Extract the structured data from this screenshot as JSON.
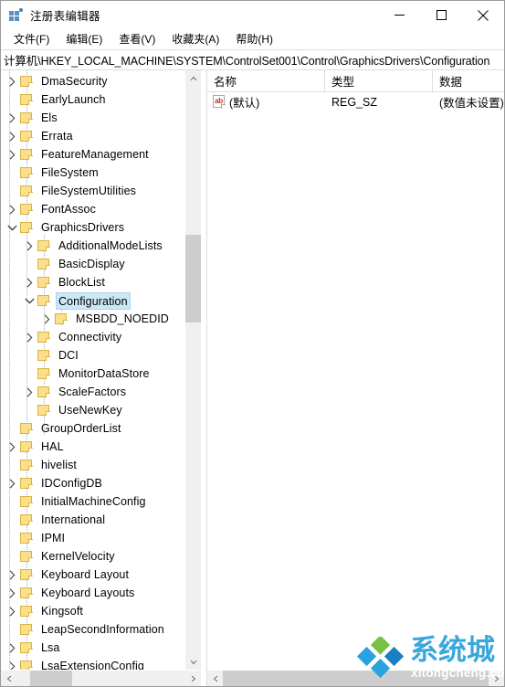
{
  "window": {
    "title": "注册表编辑器",
    "icon": "registry-editor-icon",
    "controls": {
      "minimize": "minimize-button",
      "maximize": "maximize-button",
      "close": "close-button"
    }
  },
  "menubar": {
    "items": [
      {
        "label": "文件(F)",
        "name": "menu-file"
      },
      {
        "label": "编辑(E)",
        "name": "menu-edit"
      },
      {
        "label": "查看(V)",
        "name": "menu-view"
      },
      {
        "label": "收藏夹(A)",
        "name": "menu-favorites"
      },
      {
        "label": "帮助(H)",
        "name": "menu-help"
      }
    ]
  },
  "address": {
    "path": "计算机\\HKEY_LOCAL_MACHINE\\SYSTEM\\ControlSet001\\Control\\GraphicsDrivers\\Configuration"
  },
  "tree": {
    "rows": [
      {
        "label": "DmaSecurity",
        "depth": 1,
        "expander": "collapsed",
        "selected": false
      },
      {
        "label": "EarlyLaunch",
        "depth": 1,
        "expander": "none",
        "selected": false
      },
      {
        "label": "Els",
        "depth": 1,
        "expander": "collapsed",
        "selected": false
      },
      {
        "label": "Errata",
        "depth": 1,
        "expander": "collapsed",
        "selected": false
      },
      {
        "label": "FeatureManagement",
        "depth": 1,
        "expander": "collapsed",
        "selected": false
      },
      {
        "label": "FileSystem",
        "depth": 1,
        "expander": "none",
        "selected": false
      },
      {
        "label": "FileSystemUtilities",
        "depth": 1,
        "expander": "none",
        "selected": false
      },
      {
        "label": "FontAssoc",
        "depth": 1,
        "expander": "collapsed",
        "selected": false
      },
      {
        "label": "GraphicsDrivers",
        "depth": 1,
        "expander": "expanded",
        "selected": false
      },
      {
        "label": "AdditionalModeLists",
        "depth": 2,
        "expander": "collapsed",
        "selected": false
      },
      {
        "label": "BasicDisplay",
        "depth": 2,
        "expander": "none",
        "selected": false
      },
      {
        "label": "BlockList",
        "depth": 2,
        "expander": "collapsed",
        "selected": false
      },
      {
        "label": "Configuration",
        "depth": 2,
        "expander": "expanded",
        "selected": true
      },
      {
        "label": "MSBDD_NOEDID",
        "depth": 3,
        "expander": "collapsed",
        "selected": false
      },
      {
        "label": "Connectivity",
        "depth": 2,
        "expander": "collapsed",
        "selected": false
      },
      {
        "label": "DCI",
        "depth": 2,
        "expander": "none",
        "selected": false
      },
      {
        "label": "MonitorDataStore",
        "depth": 2,
        "expander": "none",
        "selected": false
      },
      {
        "label": "ScaleFactors",
        "depth": 2,
        "expander": "collapsed",
        "selected": false
      },
      {
        "label": "UseNewKey",
        "depth": 2,
        "expander": "none",
        "selected": false
      },
      {
        "label": "GroupOrderList",
        "depth": 1,
        "expander": "none",
        "selected": false
      },
      {
        "label": "HAL",
        "depth": 1,
        "expander": "collapsed",
        "selected": false
      },
      {
        "label": "hivelist",
        "depth": 1,
        "expander": "none",
        "selected": false
      },
      {
        "label": "IDConfigDB",
        "depth": 1,
        "expander": "collapsed",
        "selected": false
      },
      {
        "label": "InitialMachineConfig",
        "depth": 1,
        "expander": "none",
        "selected": false
      },
      {
        "label": "International",
        "depth": 1,
        "expander": "none",
        "selected": false
      },
      {
        "label": "IPMI",
        "depth": 1,
        "expander": "none",
        "selected": false
      },
      {
        "label": "KernelVelocity",
        "depth": 1,
        "expander": "none",
        "selected": false
      },
      {
        "label": "Keyboard Layout",
        "depth": 1,
        "expander": "collapsed",
        "selected": false
      },
      {
        "label": "Keyboard Layouts",
        "depth": 1,
        "expander": "collapsed",
        "selected": false
      },
      {
        "label": "Kingsoft",
        "depth": 1,
        "expander": "collapsed",
        "selected": false
      },
      {
        "label": "LeapSecondInformation",
        "depth": 1,
        "expander": "none",
        "selected": false
      },
      {
        "label": "Lsa",
        "depth": 1,
        "expander": "collapsed",
        "selected": false
      },
      {
        "label": "LsaExtensionConfig",
        "depth": 1,
        "expander": "collapsed",
        "selected": false
      }
    ]
  },
  "list": {
    "columns": [
      {
        "label": "名称",
        "name": "column-name"
      },
      {
        "label": "类型",
        "name": "column-type"
      },
      {
        "label": "数据",
        "name": "column-data"
      }
    ],
    "rows": [
      {
        "icon": "string-value-icon",
        "name": "(默认)",
        "type": "REG_SZ",
        "data": "(数值未设置)"
      }
    ]
  },
  "watermark": {
    "cn": "系统城",
    "en": "xitongcheng.com"
  },
  "colors": {
    "selection": "#cce8f7",
    "selection_border": "#aad3ec",
    "folder": "#fbdf8b",
    "folder_border": "#d9b441",
    "watermark_blue": "#3aa7dc",
    "scrollbar_thumb": "#cdcdcd",
    "scrollbar_track": "#f0f0f0"
  }
}
